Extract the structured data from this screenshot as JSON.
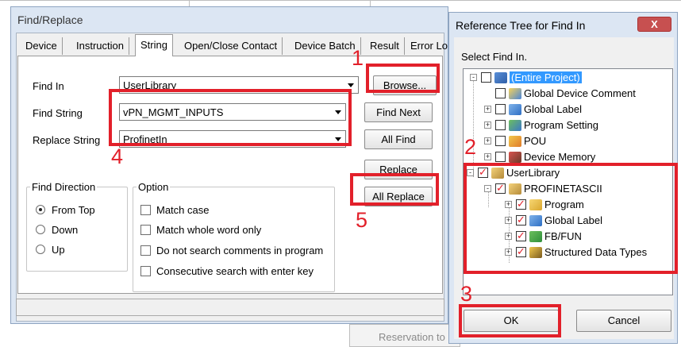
{
  "find_replace": {
    "title": "Find/Replace",
    "tabs": [
      "Device",
      "Instruction",
      "String",
      "Open/Close Contact",
      "Device Batch",
      "Result",
      "Error Lo"
    ],
    "find_in": {
      "label": "Find In",
      "value": "UserLibrary"
    },
    "find_string": {
      "label": "Find String",
      "value": "vPN_MGMT_INPUTS"
    },
    "replace_string": {
      "label": "Replace String",
      "value": "ProfinetIn"
    },
    "buttons": {
      "browse": "Browse...",
      "find_next": "Find Next",
      "all_find": "All Find",
      "replace": "Replace",
      "all_replace": "All Replace"
    },
    "find_direction": {
      "legend": "Find Direction",
      "options": [
        "From Top",
        "Down",
        "Up"
      ],
      "selected": "From Top"
    },
    "option": {
      "legend": "Option",
      "items": [
        "Match case",
        "Match whole word only",
        "Do not search comments in program",
        "Consecutive search with enter key"
      ]
    }
  },
  "reference_tree": {
    "title": "Reference Tree for Find In",
    "close_label": "X",
    "instruction": "Select Find In.",
    "nodes": [
      {
        "label": "(Entire Project)",
        "checked": false,
        "expander": "-",
        "icon": "project-icon",
        "selected": true
      },
      {
        "label": "Global Device Comment",
        "checked": false,
        "expander": "",
        "icon": "comment-icon"
      },
      {
        "label": "Global Label",
        "checked": false,
        "expander": "+",
        "icon": "label-icon"
      },
      {
        "label": "Program Setting",
        "checked": false,
        "expander": "+",
        "icon": "program-setting-icon"
      },
      {
        "label": "POU",
        "checked": false,
        "expander": "+",
        "icon": "pou-icon"
      },
      {
        "label": "Device Memory",
        "checked": false,
        "expander": "+",
        "icon": "device-memory-icon"
      },
      {
        "label": "UserLibrary",
        "checked": true,
        "expander": "-",
        "icon": "library-icon"
      },
      {
        "label": "PROFINETASCII",
        "checked": true,
        "expander": "-",
        "icon": "library-icon"
      },
      {
        "label": "Program",
        "checked": true,
        "expander": "+",
        "icon": "program-folder-icon"
      },
      {
        "label": "Global Label",
        "checked": true,
        "expander": "+",
        "icon": "label-icon"
      },
      {
        "label": "FB/FUN",
        "checked": true,
        "expander": "+",
        "icon": "fbfun-icon"
      },
      {
        "label": "Structured Data Types",
        "checked": true,
        "expander": "+",
        "icon": "structured-data-icon"
      }
    ],
    "ok_label": "OK",
    "cancel_label": "Cancel"
  },
  "annotations": [
    "1",
    "2",
    "3",
    "4",
    "5"
  ],
  "background": {
    "reservation_text": "Reservation to"
  },
  "colors": {
    "highlight_red": "#e2202a",
    "selection_blue": "#3399ff"
  }
}
